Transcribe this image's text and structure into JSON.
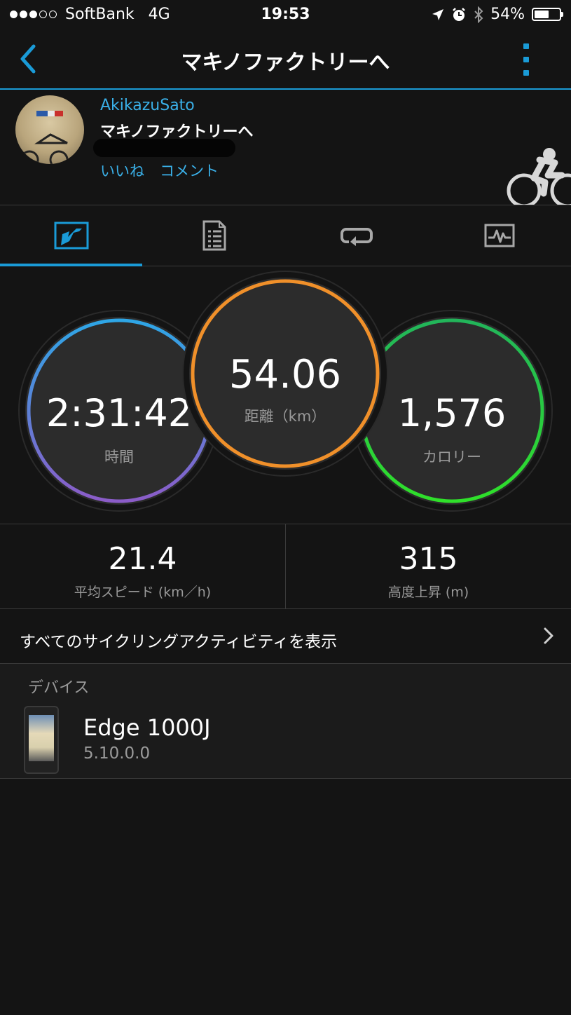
{
  "status": {
    "carrier": "SoftBank",
    "network": "4G",
    "time": "19:53",
    "battery": "54%",
    "signal_bars": 3,
    "icons": [
      "location-arrow-icon",
      "alarm-icon",
      "bluetooth-icon",
      "battery-icon"
    ]
  },
  "nav": {
    "title": "マキノファクトリーへ",
    "back_icon": "chevron-left-icon",
    "more_icon": "more-vertical-icon",
    "accent": "#1a9bd7"
  },
  "activity": {
    "user": "AkikazuSato",
    "title": "マキノファクトリーへ",
    "like": "いいね",
    "comment": "コメント",
    "activity_icon": "cycling-icon"
  },
  "tabs": [
    {
      "icon": "overview-chart-icon",
      "active": true
    },
    {
      "icon": "details-list-icon",
      "active": false
    },
    {
      "icon": "laps-loop-icon",
      "active": false
    },
    {
      "icon": "graph-monitor-icon",
      "active": false
    }
  ],
  "circles": {
    "time": {
      "value": "2:31:42",
      "label": "時間"
    },
    "distance": {
      "value": "54.06",
      "label": "距離（km）"
    },
    "calories": {
      "value": "1,576",
      "label": "カロリー"
    }
  },
  "stats": {
    "avg_speed": {
      "value": "21.4",
      "label": "平均スピード (km／h)"
    },
    "elevation": {
      "value": "315",
      "label": "高度上昇 (m)"
    }
  },
  "all_activities": {
    "label": "すべてのサイクリングアクティビティを表示"
  },
  "device": {
    "section_title": "デバイス",
    "name": "Edge 1000J",
    "version": "5.10.0.0"
  }
}
